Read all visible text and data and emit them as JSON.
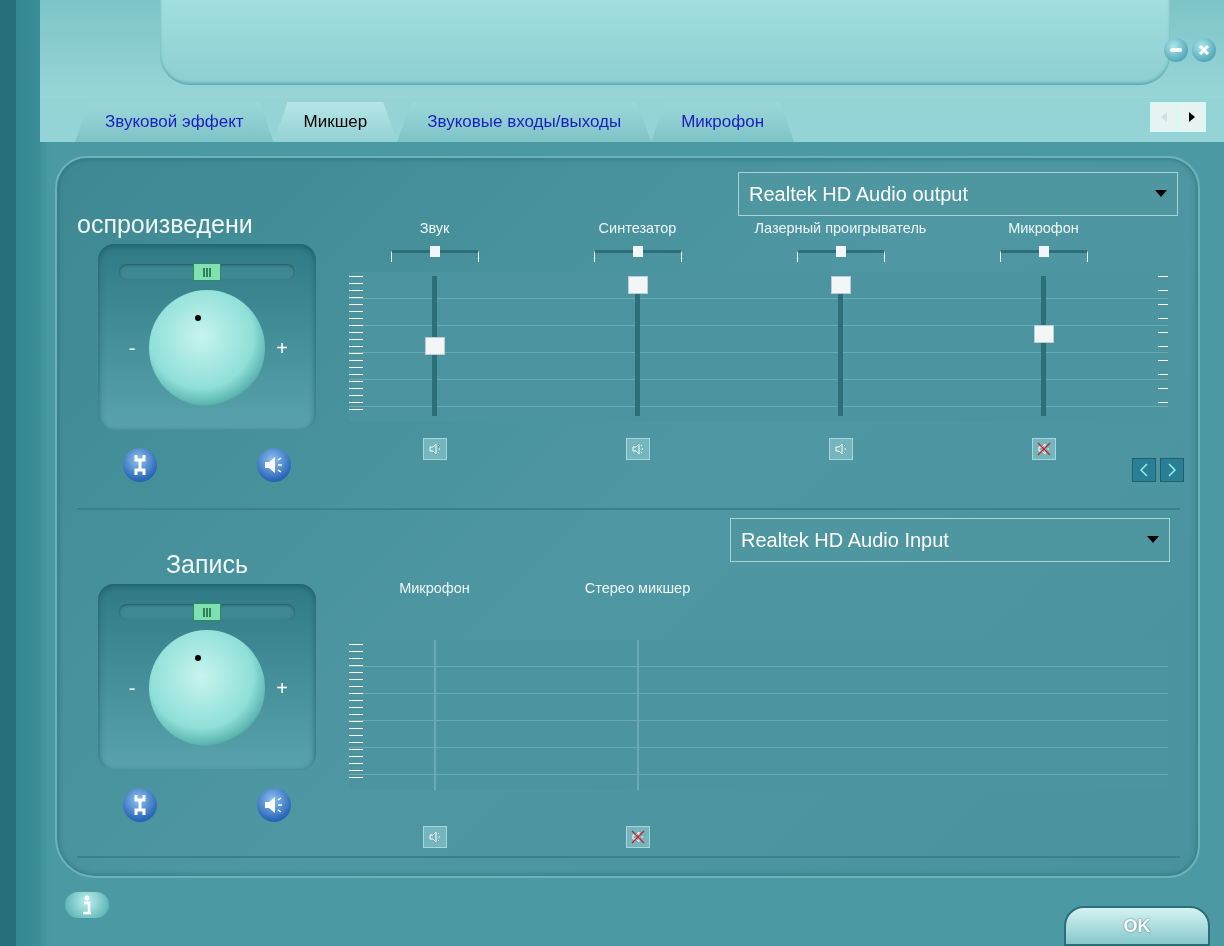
{
  "tabs": [
    {
      "label": "Звуковой эффект",
      "selected": false
    },
    {
      "label": "Микшер",
      "selected": true
    },
    {
      "label": "Звуковые входы/выходы",
      "selected": false
    },
    {
      "label": "Микрофон",
      "selected": false
    }
  ],
  "playback": {
    "title": "оспроизведени",
    "balance": {
      "level": 0.5
    },
    "minus": "-",
    "plus": "+",
    "device": "Realtek HD Audio output",
    "channels": [
      {
        "name": "Звук",
        "balance": {
          "level": 0.5
        },
        "level": 0.5,
        "muted": false
      },
      {
        "name": "Синтезатор",
        "balance": {
          "level": 0.5
        },
        "level": 1,
        "muted": false
      },
      {
        "name": "Лазерный проигрыватель",
        "balance": {
          "level": 0.5
        },
        "level": 1,
        "muted": false
      },
      {
        "name": "Микрофон",
        "balance": {
          "level": 0.5
        },
        "level": 0.6,
        "muted": true
      }
    ]
  },
  "recording": {
    "title": "Запись",
    "balance": {
      "level": 0.5
    },
    "minus": "-",
    "plus": "+",
    "device": "Realtek HD Audio Input",
    "channels": [
      {
        "name": "Микрофон",
        "muted": false
      },
      {
        "name": "Стерео микшер",
        "muted": true
      }
    ]
  },
  "ok_button": "OK"
}
